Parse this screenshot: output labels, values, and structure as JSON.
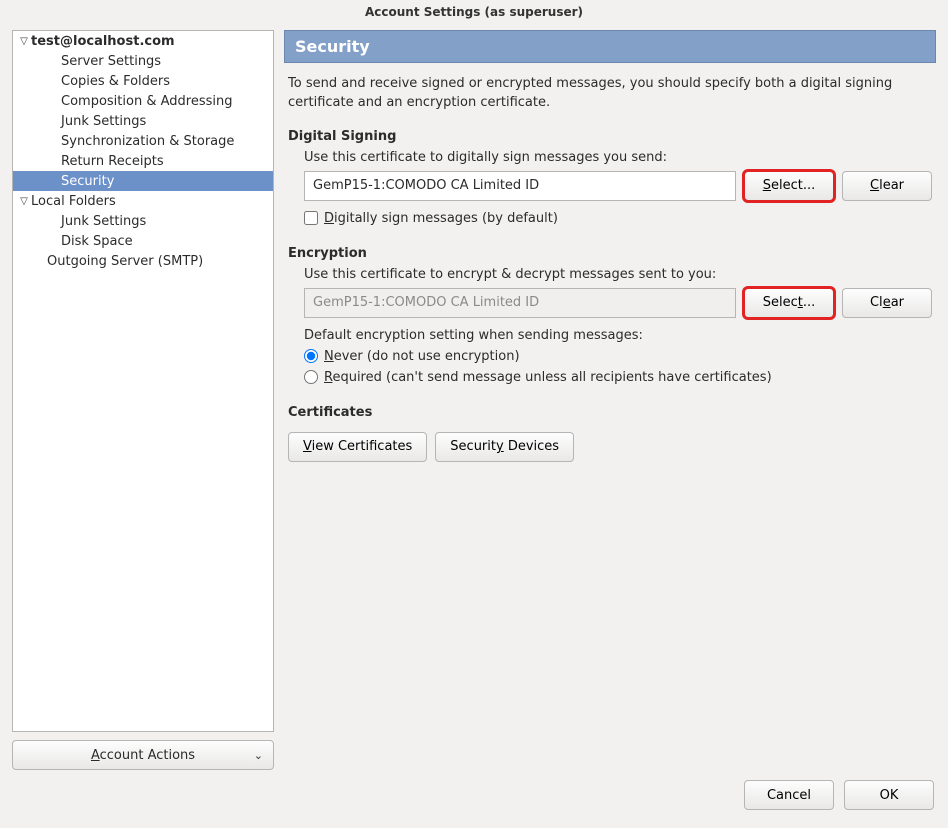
{
  "window_title": "Account Settings (as superuser)",
  "sidebar": {
    "account_actions_label": "Account Actions",
    "items": [
      {
        "label": "test@localhost.com",
        "bold": true,
        "twisty": "▽",
        "indent": 0
      },
      {
        "label": "Server Settings",
        "indent": 2
      },
      {
        "label": "Copies & Folders",
        "indent": 2
      },
      {
        "label": "Composition & Addressing",
        "indent": 2
      },
      {
        "label": "Junk Settings",
        "indent": 2
      },
      {
        "label": "Synchronization & Storage",
        "indent": 2
      },
      {
        "label": "Return Receipts",
        "indent": 2
      },
      {
        "label": "Security",
        "indent": 2,
        "selected": true
      },
      {
        "label": "Local Folders",
        "twisty": "▽",
        "indent": 0
      },
      {
        "label": "Junk Settings",
        "indent": 2
      },
      {
        "label": "Disk Space",
        "indent": 2
      },
      {
        "label": "Outgoing Server (SMTP)",
        "indent": 1
      }
    ]
  },
  "panel": {
    "title": "Security",
    "intro": "To send and receive signed or encrypted messages, you should specify both a digital signing certificate and an encryption certificate.",
    "signing": {
      "heading": "Digital Signing",
      "line": "Use this certificate to digitally sign messages you send:",
      "value": "GemP15-1:COMODO CA Limited ID",
      "select_label": "Select...",
      "clear_label": "Clear",
      "chk_label": "Digitally sign messages (by default)",
      "chk_checked": false
    },
    "encryption": {
      "heading": "Encryption",
      "line": "Use this certificate to encrypt & decrypt messages sent to you:",
      "value": "GemP15-1:COMODO CA Limited ID",
      "select_label": "Select...",
      "clear_label": "Clear",
      "default_line": "Default encryption setting when sending messages:",
      "never_label": "Never (do not use encryption)",
      "required_label": "Required (can't send message unless all recipients have certificates)",
      "selected": "never"
    },
    "certs": {
      "heading": "Certificates",
      "view_label": "View Certificates",
      "devices_label": "Security Devices"
    }
  },
  "footer": {
    "cancel": "Cancel",
    "ok": "OK"
  }
}
